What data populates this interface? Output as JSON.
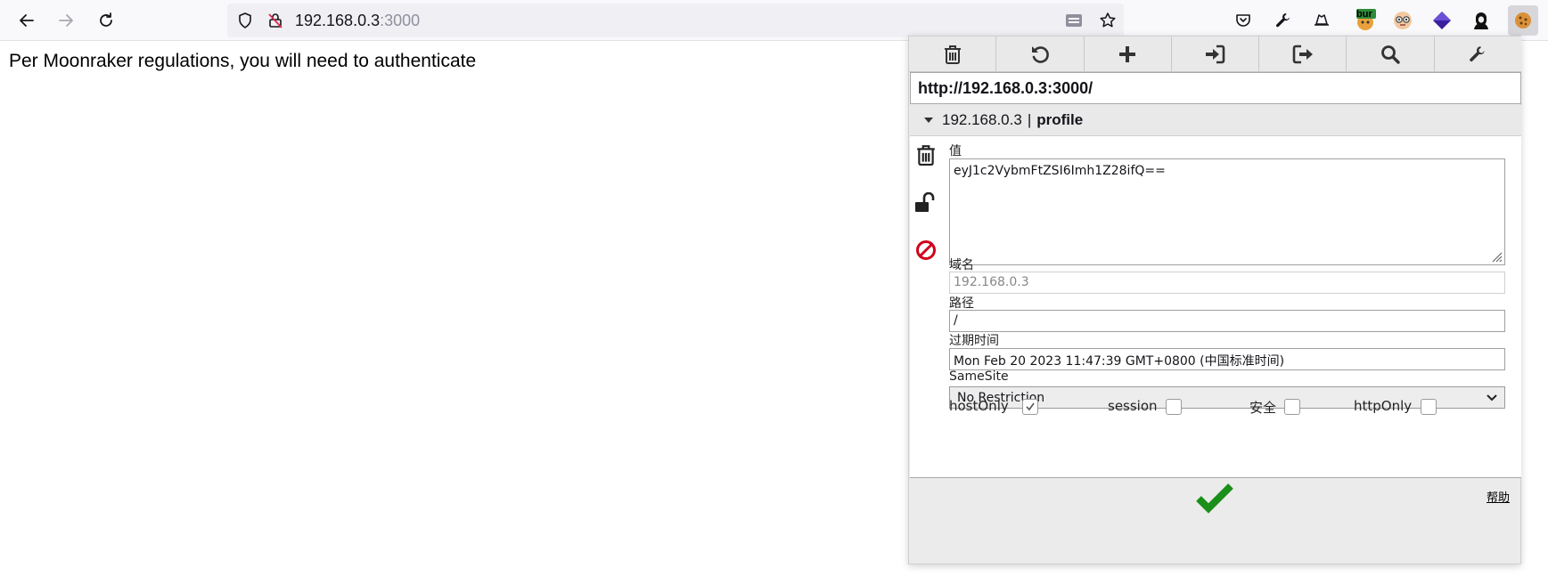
{
  "browser": {
    "url_host": "192.168.0.3",
    "url_port": ":3000",
    "extension_badge": "bur"
  },
  "page": {
    "message": "Per Moonraker regulations, you will need to authenticate"
  },
  "cookie_editor": {
    "url": "http://192.168.0.3:3000/",
    "cookie_header": {
      "domain": "192.168.0.3",
      "separator": "|",
      "name": "profile"
    },
    "value_label": "值",
    "value": "eyJ1c2VybmFtZSI6Imh1Z28ifQ==",
    "domain_label": "域名",
    "domain_placeholder": "192.168.0.3",
    "path_label": "路径",
    "path": "/",
    "expiry_label": "过期时间",
    "expiry": "Mon Feb 20 2023 11:47:39 GMT+0800 (中国标准时间)",
    "samesite_label": "SameSite",
    "samesite_value": "No Restriction",
    "checkboxes": [
      {
        "label": "hostOnly",
        "checked": true
      },
      {
        "label": "session",
        "checked": false
      },
      {
        "label": "安全",
        "checked": false
      },
      {
        "label": "httpOnly",
        "checked": false
      }
    ],
    "help_label": "帮助"
  },
  "colors": {
    "save_green": "#1a8f1a",
    "block_red": "#d0021b"
  }
}
